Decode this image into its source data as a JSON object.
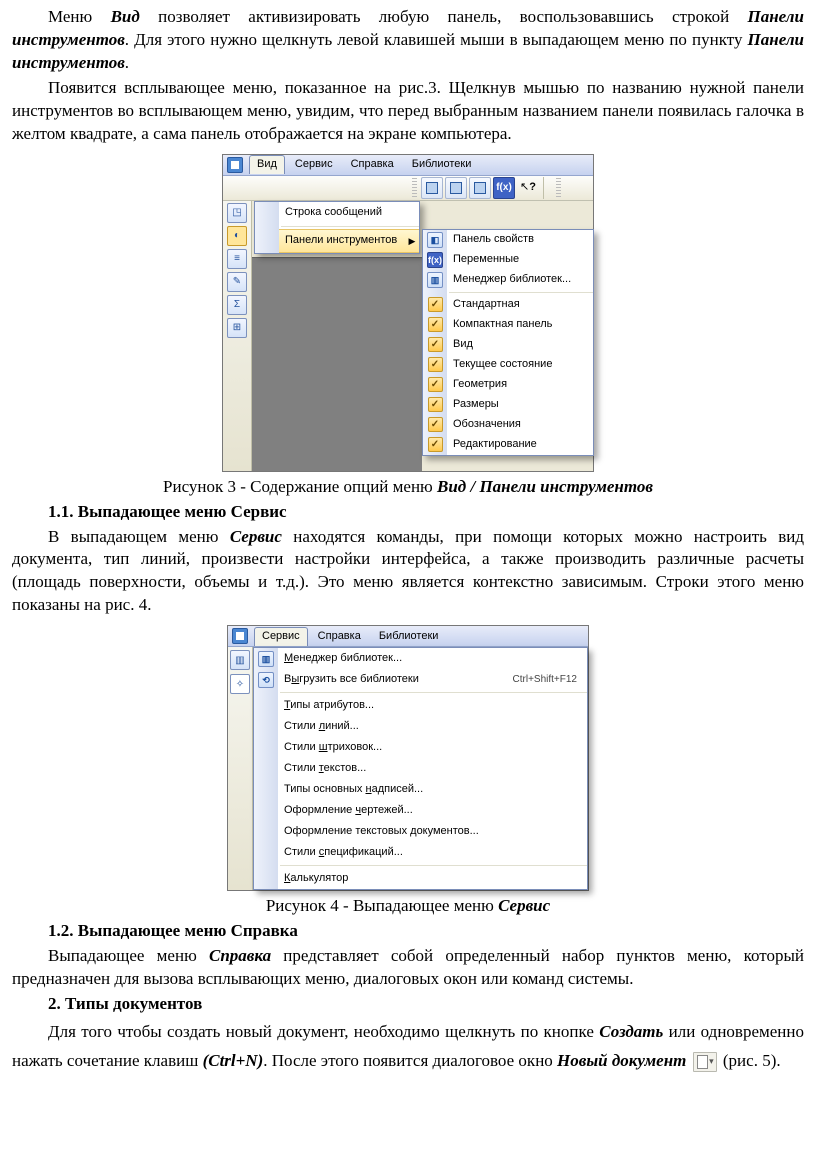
{
  "p1_a": "Меню ",
  "p1_b": "Вид",
  "p1_c": " позволяет активизировать любую панель, воспользовавшись строкой ",
  "p1_d": "Панели инструментов",
  "p1_e": ". Для этого нужно щелкнуть левой клавишей мыши в выпадающем меню по пункту ",
  "p1_f": "Панели инструментов",
  "p1_g": ".",
  "p2": "Появится всплывающее меню, показанное на рис.3. Щелкнув мышью по названию нужной панели инструментов во всплывающем меню, увидим, что перед выбранным названием панели появилась галочка в желтом квадрате, а сама панель отображается на экране компьютера.",
  "fig3": {
    "menubar": [
      "Вид",
      "Сервис",
      "Справка",
      "Библиотеки"
    ],
    "menu1": [
      "Строка сообщений",
      "Панели инструментов"
    ],
    "toolbar_fx": "f(x)",
    "toolbar_help": "?",
    "submenu": [
      {
        "label": "Панель свойств",
        "icon": "props"
      },
      {
        "label": "Переменные",
        "icon": "fx"
      },
      {
        "label": "Менеджер библиотек...",
        "icon": "books"
      },
      {
        "sep": true
      },
      {
        "label": "Стандартная",
        "chk": true
      },
      {
        "label": "Компактная панель",
        "chk": true
      },
      {
        "label": "Вид",
        "chk": true
      },
      {
        "label": "Текущее состояние",
        "chk": true
      },
      {
        "label": "Геометрия",
        "chk": true
      },
      {
        "label": "Размеры",
        "chk": true
      },
      {
        "label": "Обозначения",
        "chk": true
      },
      {
        "label": "Редактирование",
        "chk": true
      }
    ]
  },
  "cap3_a": "Рисунок 3 - Содержание опций меню ",
  "cap3_b": "Вид / Панели инструментов",
  "h11": "1.1.  Выпадающее меню Сервис",
  "p3_a": "В выпадающем меню ",
  "p3_b": "Сервис",
  "p3_c": " находятся команды, при помощи которых можно настроить вид документа, тип линий, произвести настройки интерфейса, а также производить различные расчеты (площадь поверхности, объемы и т.д.). Это меню является контекстно зависимым. Строки этого меню показаны на рис. 4.",
  "fig4": {
    "menubar": [
      "Сервис",
      "Справка",
      "Библиотеки"
    ],
    "menu": [
      {
        "label": "Менеджер библиотек...",
        "u": "М",
        "icon": "books"
      },
      {
        "label": "Выгрузить все библиотеки",
        "u": "ы",
        "icon": "unload",
        "shortcut": "Ctrl+Shift+F12"
      },
      {
        "sep": true
      },
      {
        "label": "Типы атрибутов...",
        "u": "Т"
      },
      {
        "label": "Стили линий...",
        "u": "л"
      },
      {
        "label": "Стили штриховок...",
        "u": "ш"
      },
      {
        "label": "Стили текстов...",
        "u": "т"
      },
      {
        "label": "Типы основных надписей...",
        "u": "н"
      },
      {
        "label": "Оформление чертежей...",
        "u": "ч"
      },
      {
        "label": "Оформление текстовых документов...",
        "u": "д"
      },
      {
        "label": "Стили спецификаций...",
        "u": "с"
      },
      {
        "sep": true
      },
      {
        "label": "Калькулятор",
        "u": "К"
      }
    ]
  },
  "cap4_a": "Рисунок 4 - Выпадающее меню ",
  "cap4_b": "Сервис",
  "h12": "1.2.  Выпадающее меню Справка",
  "p4_a": "Выпадающее меню ",
  "p4_b": "Справка",
  "p4_c": " представляет собой определенный набор пунктов меню, который предназначен для вызова всплывающих меню, диалоговых окон или команд системы.",
  "h2": "2. Типы документов",
  "p5_a": "Для того чтобы создать новый документ, необходимо щелкнуть по кнопке ",
  "p5_b": "Создать",
  "p5_c": " или одновременно нажать сочетание клавиш ",
  "p5_d": "(Ctrl+N)",
  "p5_e": ". После этого появится диалоговое окно ",
  "p5_f": "Новый документ",
  "p5_g": " (рис. 5)."
}
